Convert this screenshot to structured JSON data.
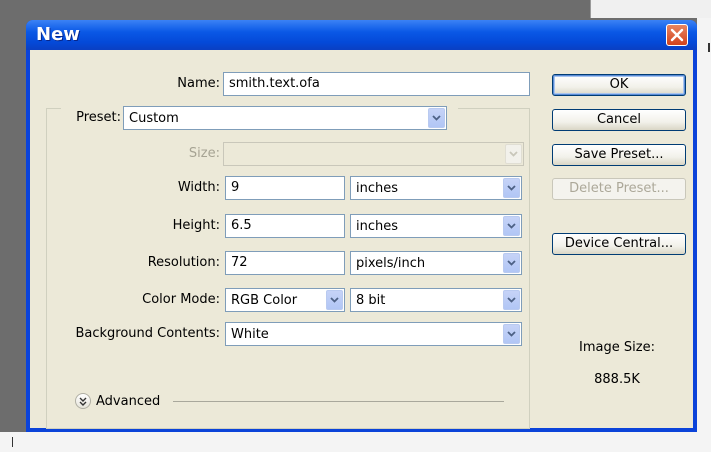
{
  "dialog": {
    "title": "New",
    "close_icon": "close-icon"
  },
  "form": {
    "name_label": "Name:",
    "name_value": "smith.text.ofa",
    "preset_label": "Preset:",
    "preset_value": "Custom",
    "size_label": "Size:",
    "size_value": "",
    "width_label": "Width:",
    "width_value": "9",
    "width_unit": "inches",
    "height_label": "Height:",
    "height_value": "6.5",
    "height_unit": "inches",
    "resolution_label": "Resolution:",
    "resolution_value": "72",
    "resolution_unit": "pixels/inch",
    "color_mode_label": "Color Mode:",
    "color_mode_value": "RGB Color",
    "bit_depth_value": "8 bit",
    "background_label": "Background Contents:",
    "background_value": "White",
    "advanced_label": "Advanced"
  },
  "buttons": {
    "ok": "OK",
    "cancel": "Cancel",
    "save_preset": "Save Preset...",
    "delete_preset": "Delete Preset...",
    "device_central": "Device Central..."
  },
  "info": {
    "image_size_label": "Image Size:",
    "image_size_value": "888.5K"
  },
  "colors": {
    "titlebar": "#0a58e6",
    "dialog_bg": "#ece9d8",
    "close_button": "#d2421b"
  }
}
